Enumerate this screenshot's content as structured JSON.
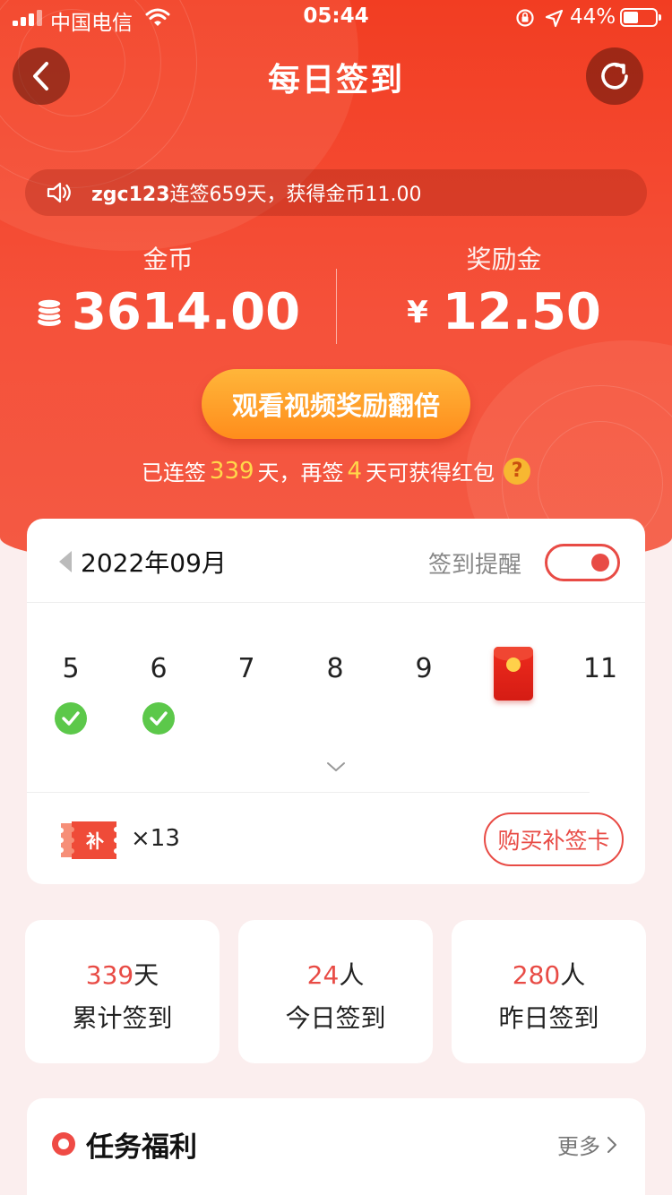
{
  "status_bar": {
    "carrier": "中国电信",
    "time": "05:44",
    "battery_pct": "44%",
    "battery_level": 0.44,
    "icons": [
      "signal-icon",
      "wifi-icon",
      "orientation-lock-icon",
      "location-icon",
      "battery-icon"
    ]
  },
  "nav": {
    "title": "每日签到",
    "back_icon": "chevron-left-icon",
    "refresh_icon": "refresh-icon"
  },
  "ticker": {
    "user": "zgc123",
    "text": "连签659天，获得金币11.00",
    "icon": "speaker-icon"
  },
  "balances": {
    "coins_label": "金币",
    "coins_value": "3614.00",
    "reward_label": "奖励金",
    "reward_currency": "¥",
    "reward_value": "12.50"
  },
  "double_button": "观看视频奖励翻倍",
  "streak": {
    "prefix": "已连签",
    "days": "339",
    "mid": "天，再签",
    "remaining": "4",
    "suffix": "天可获得红包",
    "help": "?"
  },
  "calendar": {
    "month": "2022年09月",
    "reminder_label": "签到提醒",
    "reminder_on": true,
    "days": [
      {
        "label": "5",
        "signed": true
      },
      {
        "label": "6",
        "signed": true
      },
      {
        "label": "7",
        "signed": false
      },
      {
        "label": "8",
        "signed": false
      },
      {
        "label": "9",
        "signed": false
      },
      {
        "label": "",
        "red_envelope": true
      },
      {
        "label": "11",
        "signed": false
      }
    ],
    "makeup_card_count": "×13",
    "makeup_card_icon_text": "补",
    "buy_button": "购买补签卡"
  },
  "stats": [
    {
      "value": "339",
      "unit": "天",
      "label": "累计签到"
    },
    {
      "value": "24",
      "unit": "人",
      "label": "今日签到"
    },
    {
      "value": "280",
      "unit": "人",
      "label": "昨日签到"
    }
  ],
  "tasks": {
    "title": "任务福利",
    "more": "更多"
  },
  "colors": {
    "brand_red": "#e84b45",
    "hero_red": "#f23d22",
    "button_orange": "#ff9a22",
    "highlight_yellow": "#ffd84a",
    "check_green": "#5cc84a"
  }
}
